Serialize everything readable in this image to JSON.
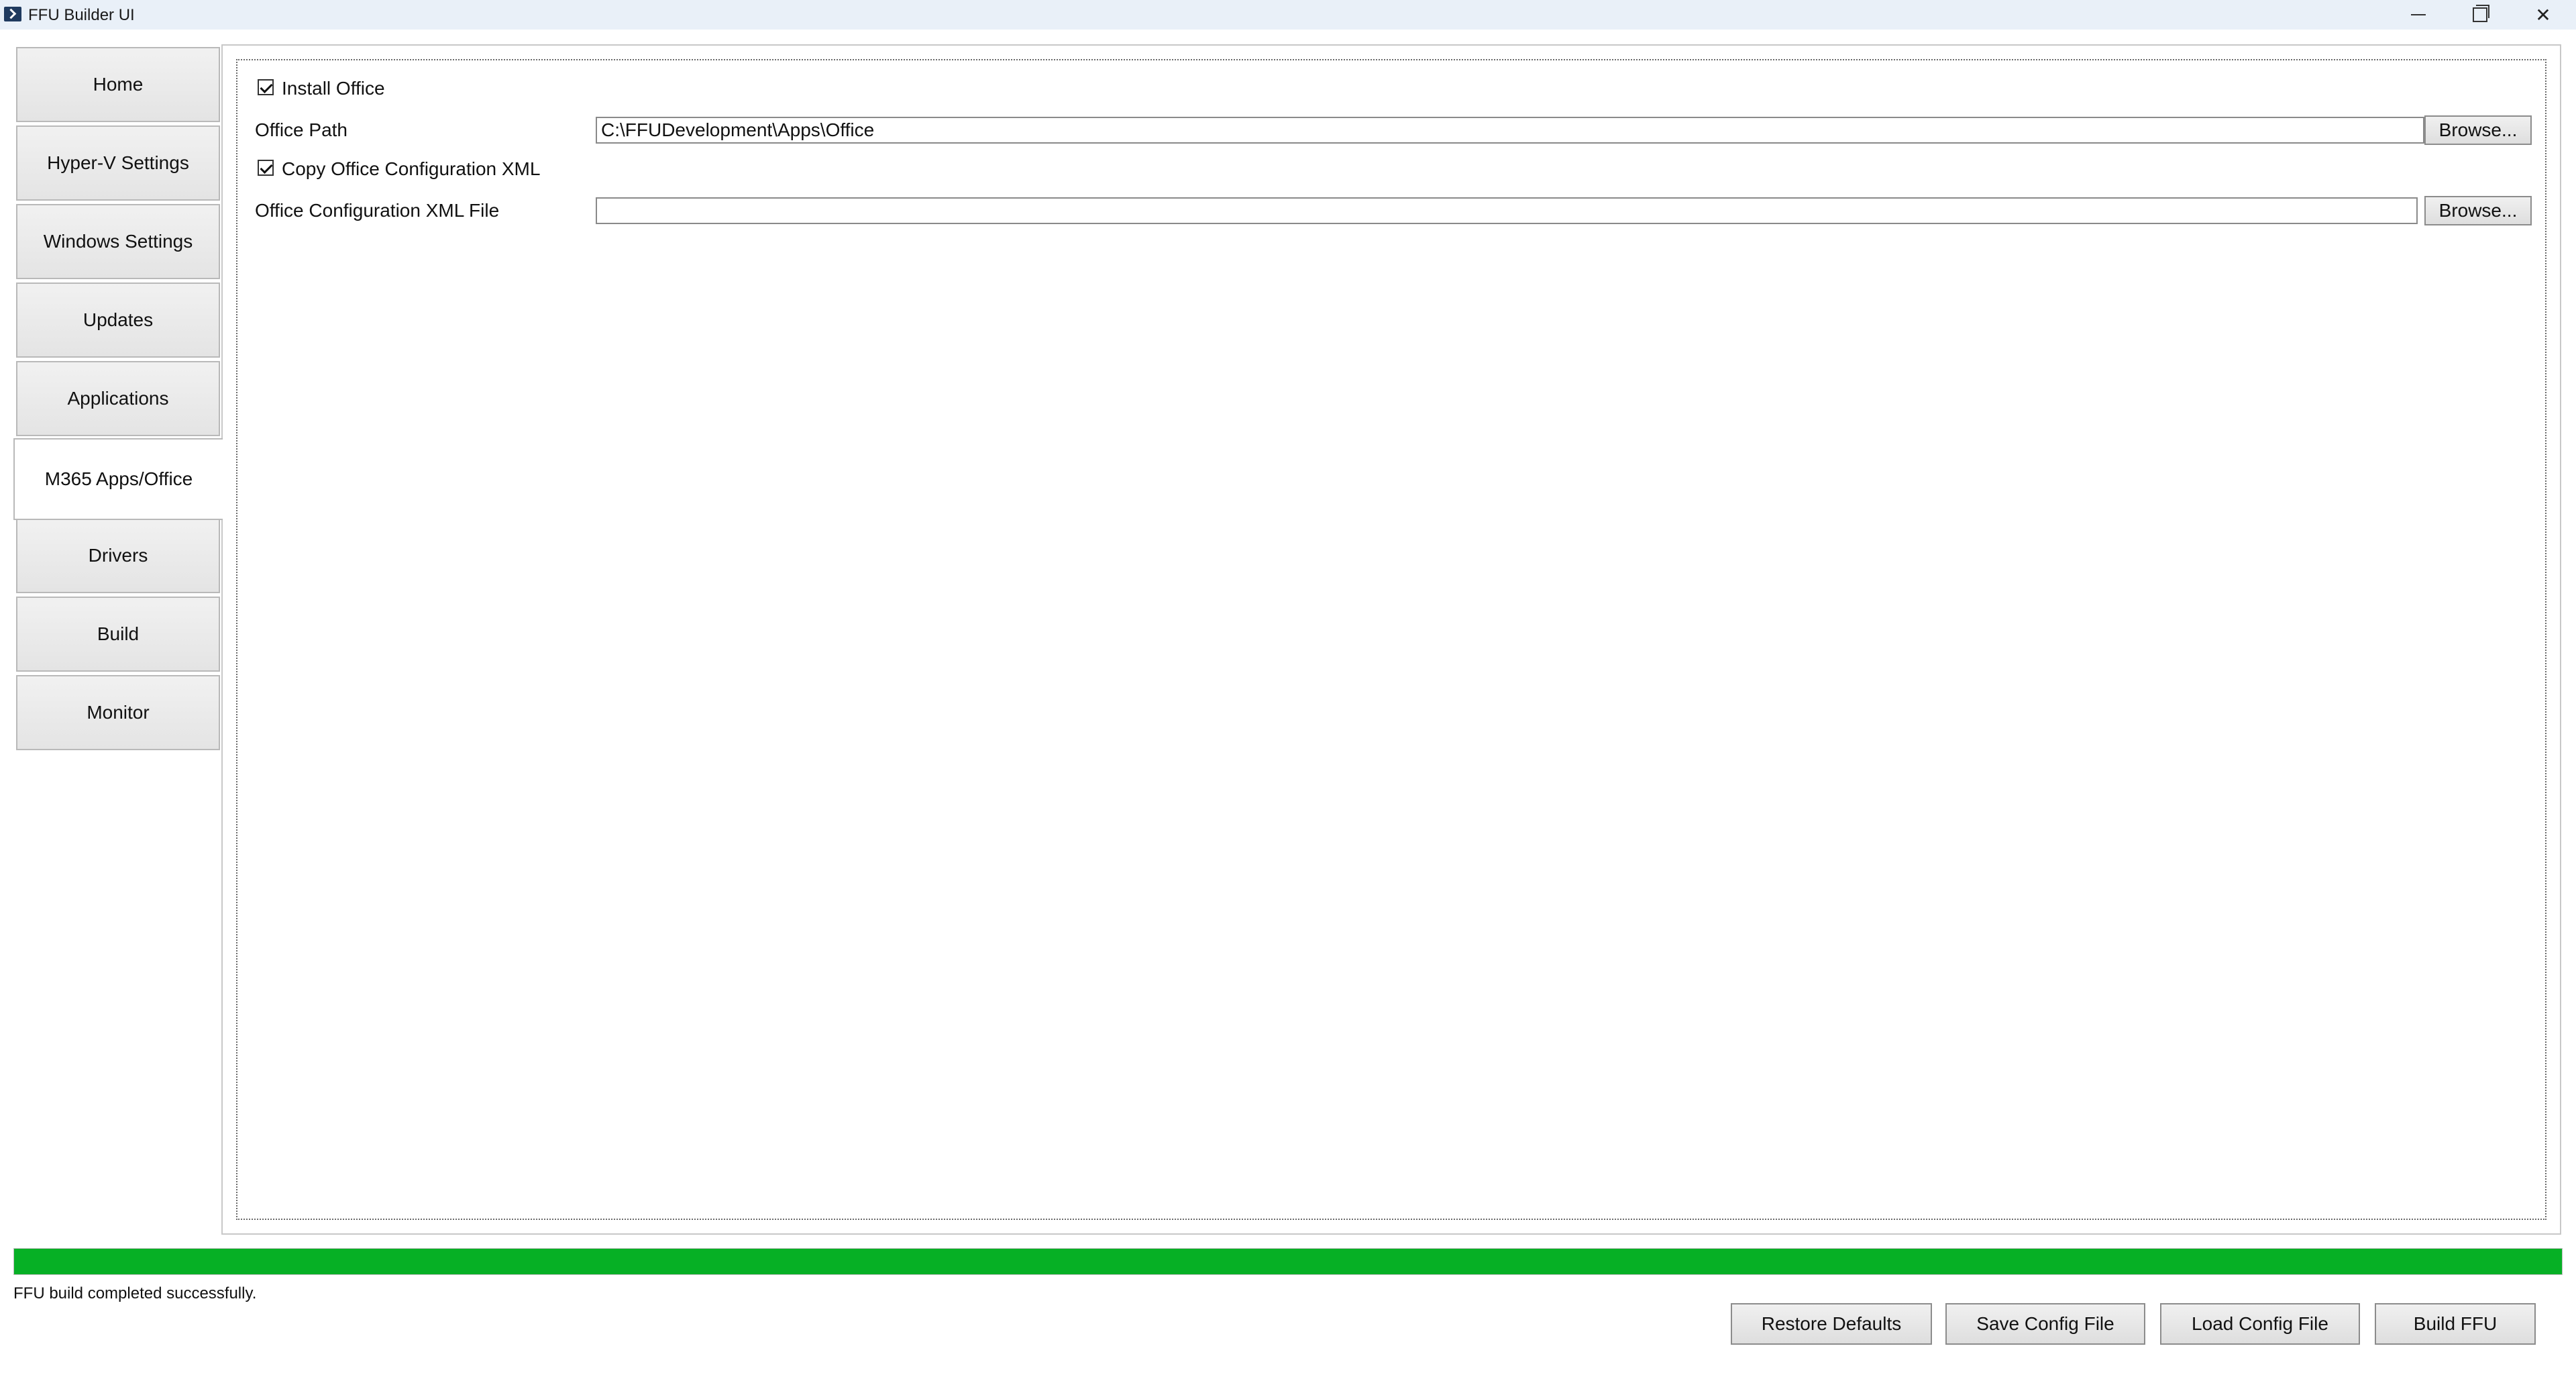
{
  "window": {
    "title": "FFU Builder UI",
    "icon": "powershell-icon"
  },
  "sidebar": {
    "items": [
      {
        "label": "Home"
      },
      {
        "label": "Hyper-V Settings"
      },
      {
        "label": "Windows Settings"
      },
      {
        "label": "Updates"
      },
      {
        "label": "Applications"
      },
      {
        "label": "M365 Apps/Office",
        "active": true
      },
      {
        "label": "Drivers"
      },
      {
        "label": "Build"
      },
      {
        "label": "Monitor"
      }
    ]
  },
  "office": {
    "install_office_label": "Install Office",
    "install_office_checked": true,
    "office_path_label": "Office Path",
    "office_path_value": "C:\\FFUDevelopment\\Apps\\Office",
    "copy_xml_label": "Copy Office Configuration XML",
    "copy_xml_checked": true,
    "xml_file_label": "Office Configuration XML File",
    "xml_file_value": "",
    "browse_label": "Browse..."
  },
  "progress": {
    "percent": 100,
    "color": "#06b025"
  },
  "status": {
    "text": "FFU build completed successfully."
  },
  "actions": {
    "restore_defaults": "Restore Defaults",
    "save_config": "Save Config File",
    "load_config": "Load Config File",
    "build_ffu": "Build FFU"
  }
}
